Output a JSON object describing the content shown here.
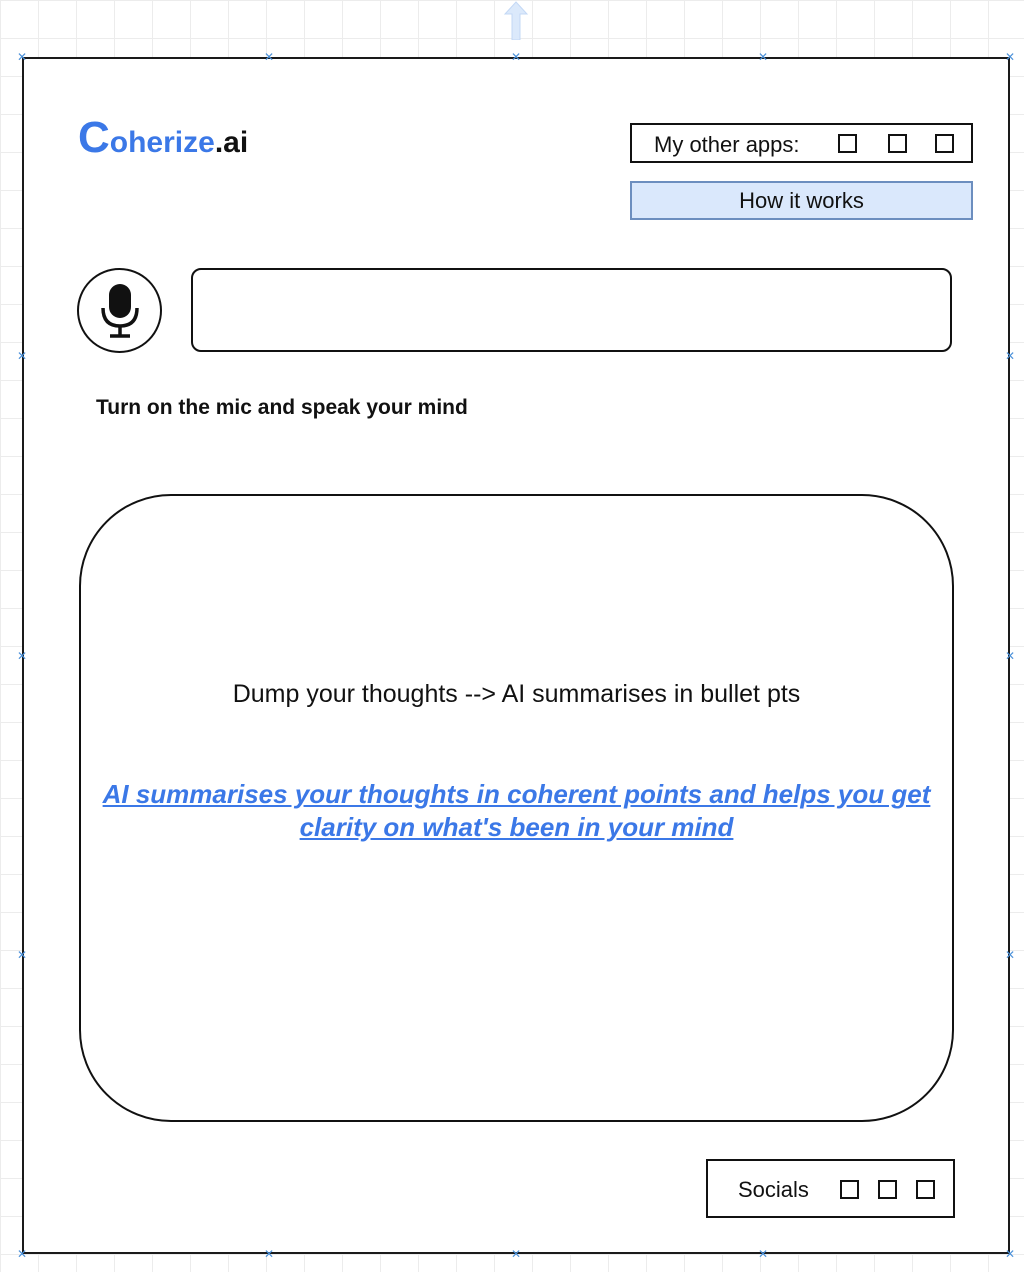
{
  "logo": {
    "first_letter": "C",
    "rest": "oherize",
    "suffix": ".ai"
  },
  "header": {
    "other_apps_label": "My other apps:",
    "how_it_works_label": "How it works"
  },
  "input": {
    "mic_icon": "microphone-icon",
    "text_value": "",
    "hint": "Turn on the mic and speak your mind"
  },
  "output": {
    "title": "Dump your thoughts --> AI summarises in bullet pts",
    "description": "AI summarises your thoughts in coherent points and helps you get clarity on what's been in your mind"
  },
  "footer": {
    "socials_label": "Socials"
  },
  "colors": {
    "brand": "#3b78e7",
    "button_fill": "#dae8fc",
    "button_border": "#6c8ebf",
    "handle": "#4a90d9"
  }
}
